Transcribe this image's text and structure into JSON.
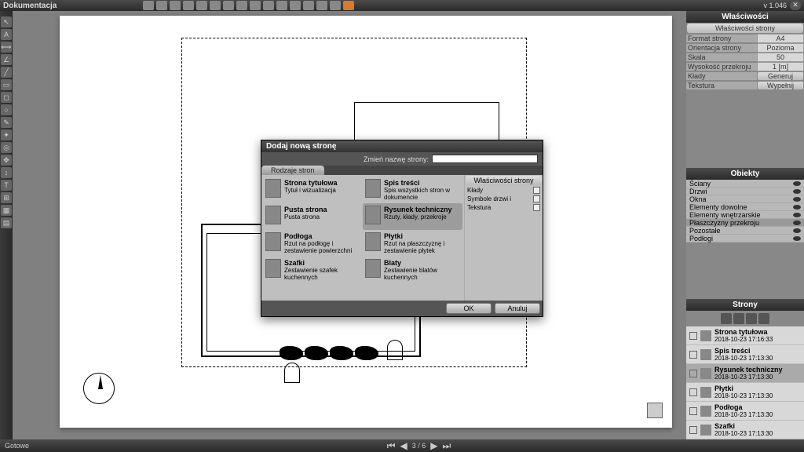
{
  "app": {
    "title": "Dokumentacja",
    "version": "v 1.046"
  },
  "status": "Gotowe",
  "pager": {
    "current": 3,
    "total": 6
  },
  "properties": {
    "header": "Właściwości",
    "section": "Właściwości strony",
    "rows": {
      "format": {
        "label": "Format strony",
        "value": "A4"
      },
      "orientation": {
        "label": "Orientacja strony",
        "value": "Pozioma"
      },
      "scale": {
        "label": "Skala",
        "value": "50"
      },
      "height": {
        "label": "Wysokość przekroju",
        "value": "1 [m]"
      }
    },
    "buttons": {
      "klady": {
        "label": "Kłady",
        "btn": "Generuj"
      },
      "texture": {
        "label": "Tekstura",
        "btn": "Wypełnij"
      }
    }
  },
  "objects": {
    "header": "Obiekty",
    "items": [
      "Ściany",
      "Drzwi",
      "Okna",
      "Elementy dowolne",
      "Elementy wnętrzarskie",
      "Płaszczyzny przekroju",
      "Pozostałe",
      "Podłogi"
    ]
  },
  "pages": {
    "header": "Strony",
    "items": [
      {
        "title": "Strona tytułowa",
        "ts": "2018-10-23 17:16:33"
      },
      {
        "title": "Spis treści",
        "ts": "2018-10-23 17:13:30"
      },
      {
        "title": "Rysunek techniczny",
        "ts": "2018-10-23 17:13:30",
        "selected": true
      },
      {
        "title": "Płytki",
        "ts": "2018-10-23 17:13:30"
      },
      {
        "title": "Podłoga",
        "ts": "2018-10-23 17:13:30"
      },
      {
        "title": "Szafki",
        "ts": "2018-10-23 17:13:30"
      }
    ]
  },
  "dialog": {
    "title": "Dodaj nową stronę",
    "rename_label": "Zmień nazwę strony:",
    "tab": "Rodzaje stron",
    "ok": "OK",
    "cancel": "Anuluj",
    "right_header": "Właściwości strony",
    "right_rows": [
      "Kłady",
      "Symbole drzwi i",
      "Tekstura"
    ],
    "types": [
      {
        "title": "Strona tytułowa",
        "desc": "Tytuł i wizualizacja"
      },
      {
        "title": "Spis treści",
        "desc": "Spis wszystkich stron w dokumencie"
      },
      {
        "title": "Pusta strona",
        "desc": "Pusta strona"
      },
      {
        "title": "Rysunek techniczny",
        "desc": "Rzuty, kłady, przekroje",
        "selected": true
      },
      {
        "title": "Podłoga",
        "desc": "Rzut na podłogę i zestawienie powierzchni"
      },
      {
        "title": "Płytki",
        "desc": "Rzut na płaszczyznę i zestawienie płytek"
      },
      {
        "title": "Szafki",
        "desc": "Zestawienie szafek kuchennych"
      },
      {
        "title": "Blaty",
        "desc": "Zestawienie blatów kuchennych"
      }
    ]
  }
}
